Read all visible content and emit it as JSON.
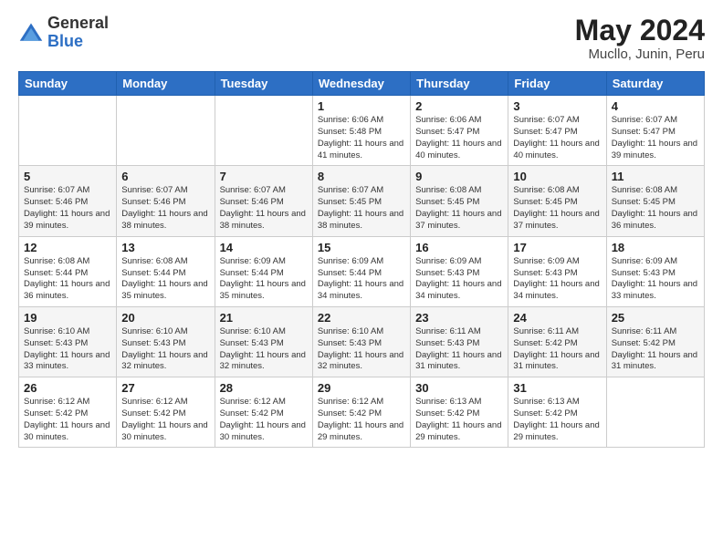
{
  "logo": {
    "general": "General",
    "blue": "Blue"
  },
  "title": {
    "month_year": "May 2024",
    "location": "Mucllo, Junin, Peru"
  },
  "weekdays": [
    "Sunday",
    "Monday",
    "Tuesday",
    "Wednesday",
    "Thursday",
    "Friday",
    "Saturday"
  ],
  "weeks": [
    [
      {
        "day": "",
        "info": ""
      },
      {
        "day": "",
        "info": ""
      },
      {
        "day": "",
        "info": ""
      },
      {
        "day": "1",
        "info": "Sunrise: 6:06 AM\nSunset: 5:48 PM\nDaylight: 11 hours and 41 minutes."
      },
      {
        "day": "2",
        "info": "Sunrise: 6:06 AM\nSunset: 5:47 PM\nDaylight: 11 hours and 40 minutes."
      },
      {
        "day": "3",
        "info": "Sunrise: 6:07 AM\nSunset: 5:47 PM\nDaylight: 11 hours and 40 minutes."
      },
      {
        "day": "4",
        "info": "Sunrise: 6:07 AM\nSunset: 5:47 PM\nDaylight: 11 hours and 39 minutes."
      }
    ],
    [
      {
        "day": "5",
        "info": "Sunrise: 6:07 AM\nSunset: 5:46 PM\nDaylight: 11 hours and 39 minutes."
      },
      {
        "day": "6",
        "info": "Sunrise: 6:07 AM\nSunset: 5:46 PM\nDaylight: 11 hours and 38 minutes."
      },
      {
        "day": "7",
        "info": "Sunrise: 6:07 AM\nSunset: 5:46 PM\nDaylight: 11 hours and 38 minutes."
      },
      {
        "day": "8",
        "info": "Sunrise: 6:07 AM\nSunset: 5:45 PM\nDaylight: 11 hours and 38 minutes."
      },
      {
        "day": "9",
        "info": "Sunrise: 6:08 AM\nSunset: 5:45 PM\nDaylight: 11 hours and 37 minutes."
      },
      {
        "day": "10",
        "info": "Sunrise: 6:08 AM\nSunset: 5:45 PM\nDaylight: 11 hours and 37 minutes."
      },
      {
        "day": "11",
        "info": "Sunrise: 6:08 AM\nSunset: 5:45 PM\nDaylight: 11 hours and 36 minutes."
      }
    ],
    [
      {
        "day": "12",
        "info": "Sunrise: 6:08 AM\nSunset: 5:44 PM\nDaylight: 11 hours and 36 minutes."
      },
      {
        "day": "13",
        "info": "Sunrise: 6:08 AM\nSunset: 5:44 PM\nDaylight: 11 hours and 35 minutes."
      },
      {
        "day": "14",
        "info": "Sunrise: 6:09 AM\nSunset: 5:44 PM\nDaylight: 11 hours and 35 minutes."
      },
      {
        "day": "15",
        "info": "Sunrise: 6:09 AM\nSunset: 5:44 PM\nDaylight: 11 hours and 34 minutes."
      },
      {
        "day": "16",
        "info": "Sunrise: 6:09 AM\nSunset: 5:43 PM\nDaylight: 11 hours and 34 minutes."
      },
      {
        "day": "17",
        "info": "Sunrise: 6:09 AM\nSunset: 5:43 PM\nDaylight: 11 hours and 34 minutes."
      },
      {
        "day": "18",
        "info": "Sunrise: 6:09 AM\nSunset: 5:43 PM\nDaylight: 11 hours and 33 minutes."
      }
    ],
    [
      {
        "day": "19",
        "info": "Sunrise: 6:10 AM\nSunset: 5:43 PM\nDaylight: 11 hours and 33 minutes."
      },
      {
        "day": "20",
        "info": "Sunrise: 6:10 AM\nSunset: 5:43 PM\nDaylight: 11 hours and 32 minutes."
      },
      {
        "day": "21",
        "info": "Sunrise: 6:10 AM\nSunset: 5:43 PM\nDaylight: 11 hours and 32 minutes."
      },
      {
        "day": "22",
        "info": "Sunrise: 6:10 AM\nSunset: 5:43 PM\nDaylight: 11 hours and 32 minutes."
      },
      {
        "day": "23",
        "info": "Sunrise: 6:11 AM\nSunset: 5:43 PM\nDaylight: 11 hours and 31 minutes."
      },
      {
        "day": "24",
        "info": "Sunrise: 6:11 AM\nSunset: 5:42 PM\nDaylight: 11 hours and 31 minutes."
      },
      {
        "day": "25",
        "info": "Sunrise: 6:11 AM\nSunset: 5:42 PM\nDaylight: 11 hours and 31 minutes."
      }
    ],
    [
      {
        "day": "26",
        "info": "Sunrise: 6:12 AM\nSunset: 5:42 PM\nDaylight: 11 hours and 30 minutes."
      },
      {
        "day": "27",
        "info": "Sunrise: 6:12 AM\nSunset: 5:42 PM\nDaylight: 11 hours and 30 minutes."
      },
      {
        "day": "28",
        "info": "Sunrise: 6:12 AM\nSunset: 5:42 PM\nDaylight: 11 hours and 30 minutes."
      },
      {
        "day": "29",
        "info": "Sunrise: 6:12 AM\nSunset: 5:42 PM\nDaylight: 11 hours and 29 minutes."
      },
      {
        "day": "30",
        "info": "Sunrise: 6:13 AM\nSunset: 5:42 PM\nDaylight: 11 hours and 29 minutes."
      },
      {
        "day": "31",
        "info": "Sunrise: 6:13 AM\nSunset: 5:42 PM\nDaylight: 11 hours and 29 minutes."
      },
      {
        "day": "",
        "info": ""
      }
    ]
  ]
}
